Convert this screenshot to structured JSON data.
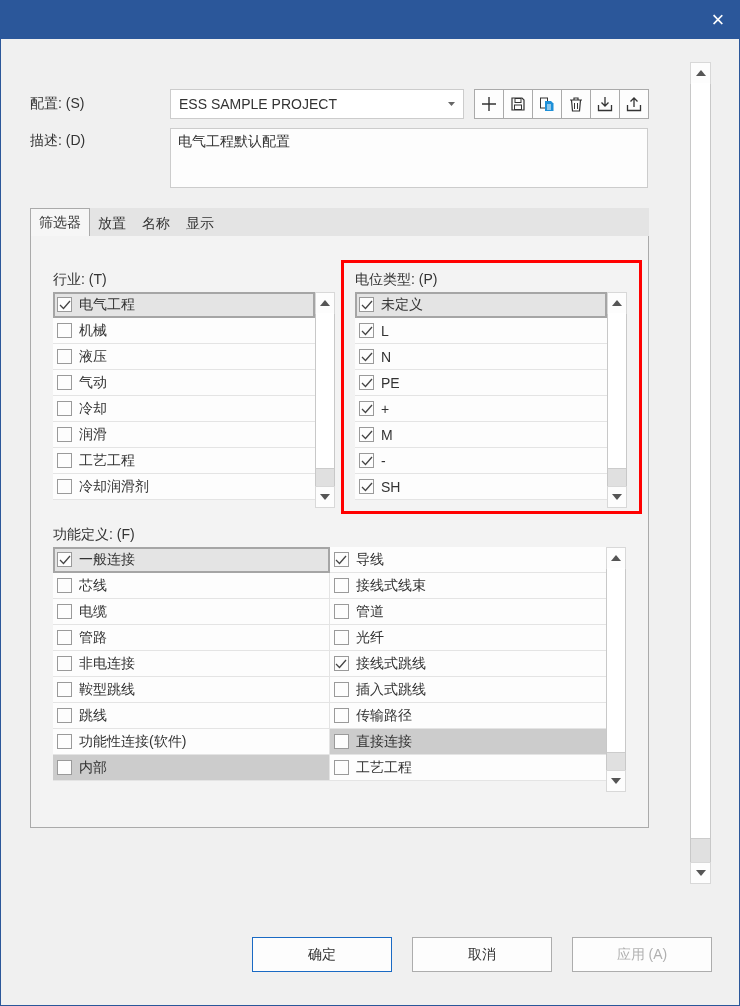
{
  "window": {
    "close_icon": "×"
  },
  "config": {
    "label": "配置: (S)",
    "value": "ESS SAMPLE PROJECT"
  },
  "toolbar": [
    {
      "kind": "add"
    },
    {
      "kind": "save"
    },
    {
      "kind": "copy"
    },
    {
      "kind": "delete"
    },
    {
      "kind": "import"
    },
    {
      "kind": "export"
    }
  ],
  "description": {
    "label": "描述: (D)",
    "value": "电气工程默认配置"
  },
  "tabs": [
    {
      "label": "筛选器",
      "selected": true
    },
    {
      "label": "放置",
      "selected": false
    },
    {
      "label": "名称",
      "selected": false
    },
    {
      "label": "显示",
      "selected": false
    }
  ],
  "industry": {
    "label": "行业: (T)",
    "items": [
      {
        "label": "电气工程",
        "checked": true,
        "focused": true,
        "selected": false
      },
      {
        "label": "机械",
        "checked": false,
        "focused": false,
        "selected": false
      },
      {
        "label": "液压",
        "checked": false,
        "focused": false,
        "selected": false
      },
      {
        "label": "气动",
        "checked": false,
        "focused": false,
        "selected": false
      },
      {
        "label": "冷却",
        "checked": false,
        "focused": false,
        "selected": false
      },
      {
        "label": "润滑",
        "checked": false,
        "focused": false,
        "selected": false
      },
      {
        "label": "工艺工程",
        "checked": false,
        "focused": false,
        "selected": false
      },
      {
        "label": "冷却润滑剂",
        "checked": false,
        "focused": false,
        "selected": false
      }
    ]
  },
  "potential": {
    "label": "电位类型: (P)",
    "highlighted": true,
    "items": [
      {
        "label": "未定义",
        "checked": true,
        "focused": true,
        "selected": false
      },
      {
        "label": "L",
        "checked": true,
        "focused": false,
        "selected": false
      },
      {
        "label": "N",
        "checked": true,
        "focused": false,
        "selected": false
      },
      {
        "label": "PE",
        "checked": true,
        "focused": false,
        "selected": false
      },
      {
        "label": "+",
        "checked": true,
        "focused": false,
        "selected": false
      },
      {
        "label": "M",
        "checked": true,
        "focused": false,
        "selected": false
      },
      {
        "label": "-",
        "checked": true,
        "focused": false,
        "selected": false
      },
      {
        "label": "SH",
        "checked": true,
        "focused": false,
        "selected": false
      }
    ]
  },
  "function": {
    "label": "功能定义: (F)",
    "items": [
      {
        "label": "一般连接",
        "checked": true,
        "focused": true,
        "selected": false
      },
      {
        "label": "导线",
        "checked": true,
        "focused": false,
        "selected": false
      },
      {
        "label": "芯线",
        "checked": false,
        "focused": false,
        "selected": false
      },
      {
        "label": "接线式线束",
        "checked": false,
        "focused": false,
        "selected": false
      },
      {
        "label": "电缆",
        "checked": false,
        "focused": false,
        "selected": false
      },
      {
        "label": "管道",
        "checked": false,
        "focused": false,
        "selected": false
      },
      {
        "label": "管路",
        "checked": false,
        "focused": false,
        "selected": false
      },
      {
        "label": "光纤",
        "checked": false,
        "focused": false,
        "selected": false
      },
      {
        "label": "非电连接",
        "checked": false,
        "focused": false,
        "selected": false
      },
      {
        "label": "接线式跳线",
        "checked": true,
        "focused": false,
        "selected": false
      },
      {
        "label": "鞍型跳线",
        "checked": false,
        "focused": false,
        "selected": false
      },
      {
        "label": "插入式跳线",
        "checked": false,
        "focused": false,
        "selected": false
      },
      {
        "label": "跳线",
        "checked": false,
        "focused": false,
        "selected": false
      },
      {
        "label": "传输路径",
        "checked": false,
        "focused": false,
        "selected": false
      },
      {
        "label": "功能性连接(软件)",
        "checked": false,
        "focused": false,
        "selected": false
      },
      {
        "label": "直接连接",
        "checked": false,
        "focused": false,
        "selected": true
      },
      {
        "label": "内部",
        "checked": false,
        "focused": false,
        "selected": true
      },
      {
        "label": "工艺工程",
        "checked": false,
        "focused": false,
        "selected": false
      }
    ]
  },
  "buttons": [
    {
      "label": "确定",
      "kind": "default",
      "disabled": false
    },
    {
      "label": "取消",
      "kind": "normal",
      "disabled": false
    },
    {
      "label": "应用 (A)",
      "kind": "normal",
      "disabled": true
    }
  ]
}
